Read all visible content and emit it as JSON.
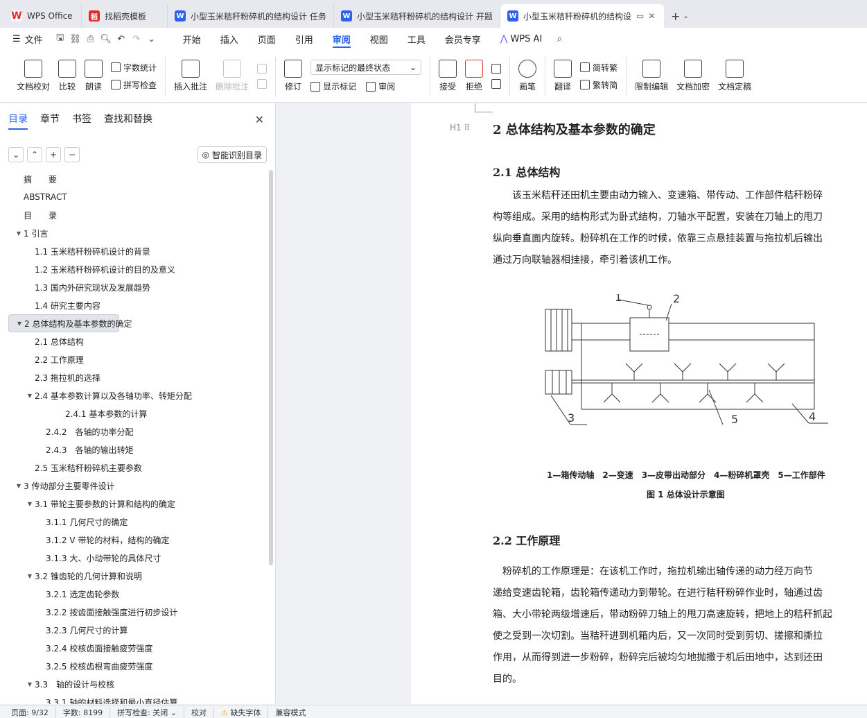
{
  "tabs": [
    {
      "label": "WPS Office",
      "icon": "wps-logo-icon"
    },
    {
      "label": "找稻壳模板",
      "icon": "docer-icon"
    },
    {
      "label": "小型玉米秸秆粉碎机的结构设计 任务",
      "icon": "word-doc-icon"
    },
    {
      "label": "小型玉米秸秆粉碎机的结构设计 开题",
      "icon": "word-doc-icon"
    },
    {
      "label": "小型玉米秸秆粉碎机的结构设",
      "icon": "word-doc-icon"
    }
  ],
  "menu": {
    "file": "文件",
    "items": [
      "开始",
      "插入",
      "页面",
      "引用",
      "审阅",
      "视图",
      "工具",
      "会员专享"
    ],
    "active": "审阅",
    "ai": "WPS AI"
  },
  "ribbon": {
    "doc_check": "文档校对",
    "compare": "比较",
    "read": "朗读",
    "word_count": "字数统计",
    "spell_check": "拼写检查",
    "insert_comment": "插入批注",
    "delete_comment": "删除批注",
    "revise": "修订",
    "markup_select": "显示标记的最终状态",
    "show_markup": "显示标记",
    "review": "审阅",
    "accept": "接受",
    "reject": "拒绝",
    "pen": "画笔",
    "translate": "翻译",
    "to_trad": "简转繁",
    "to_simp": "繁转简",
    "restrict": "限制编辑",
    "encrypt": "文档加密",
    "finalize": "文档定稿"
  },
  "nav": {
    "tabs": [
      "目录",
      "章节",
      "书签",
      "查找和替换"
    ],
    "smart_toc": "智能识别目录",
    "toc": [
      {
        "label": "摘　　要",
        "level": 0,
        "arrow": ""
      },
      {
        "label": "ABSTRACT",
        "level": 0,
        "arrow": ""
      },
      {
        "label": "目　　录",
        "level": 0,
        "arrow": ""
      },
      {
        "label": "1 引言",
        "level": 0,
        "arrow": "▼"
      },
      {
        "label": "1.1 玉米秸秆粉碎机设计的背景",
        "level": 1,
        "arrow": ""
      },
      {
        "label": "1.2 玉米秸秆粉碎机设计的目的及意义",
        "level": 1,
        "arrow": ""
      },
      {
        "label": "1.3 国内外研究现状及发展趋势",
        "level": 1,
        "arrow": ""
      },
      {
        "label": "1.4 研究主要内容",
        "level": 1,
        "arrow": ""
      },
      {
        "label": "2 总体结构及基本参数的确定",
        "level": 0,
        "arrow": "▼",
        "selected": true
      },
      {
        "label": "2.1 总体结构",
        "level": 1,
        "arrow": ""
      },
      {
        "label": "2.2 工作原理",
        "level": 1,
        "arrow": ""
      },
      {
        "label": "2.3 拖拉机的选择",
        "level": 1,
        "arrow": ""
      },
      {
        "label": "2.4 基本参数计算以及各轴功率、转矩分配",
        "level": 1,
        "arrow": "▼"
      },
      {
        "label": "2.4.1 基本参数的计算",
        "level": 3,
        "arrow": ""
      },
      {
        "label": "2.4.2　各轴的功率分配",
        "level": 2,
        "arrow": ""
      },
      {
        "label": "2.4.3　各轴的输出转矩",
        "level": 2,
        "arrow": ""
      },
      {
        "label": "2.5 玉米秸秆粉碎机主要参数",
        "level": 1,
        "arrow": ""
      },
      {
        "label": "3 传动部分主要零件设计",
        "level": 0,
        "arrow": "▼"
      },
      {
        "label": "3.1 带轮主要参数的计算和结构的确定",
        "level": 1,
        "arrow": "▼"
      },
      {
        "label": "3.1.1 几何尺寸的确定",
        "level": 2,
        "arrow": ""
      },
      {
        "label": "3.1.2 V 带轮的材料，结构的确定",
        "level": 2,
        "arrow": ""
      },
      {
        "label": "3.1.3 大、小动带轮的具体尺寸",
        "level": 2,
        "arrow": ""
      },
      {
        "label": "3.2 锥齿轮的几何计算和说明",
        "level": 1,
        "arrow": "▼"
      },
      {
        "label": "3.2.1 选定齿轮参数",
        "level": 2,
        "arrow": ""
      },
      {
        "label": "3.2.2 按齿面接触强度进行初步设计",
        "level": 2,
        "arrow": ""
      },
      {
        "label": "3.2.3 几何尺寸的计算",
        "level": 2,
        "arrow": ""
      },
      {
        "label": "3.2.4 校核齿面接触疲劳强度",
        "level": 2,
        "arrow": ""
      },
      {
        "label": "3.2.5 校核齿根弯曲疲劳强度",
        "level": 2,
        "arrow": ""
      },
      {
        "label": "3.3　轴的设计与校核",
        "level": 1,
        "arrow": "▼"
      },
      {
        "label": "3.3.1 轴的材料选择和最小直径估算",
        "level": 2,
        "arrow": ""
      }
    ]
  },
  "doc": {
    "heading_mark": "H1",
    "h1": "2 总体结构及基本参数的确定",
    "h2_1": "2.1 总体结构",
    "p1": [
      "　　该玉米秸秆还田机主要由动力输入、变速箱、带传动、工作部件秸秆粉碎",
      "构等组成。采用的结构形式为卧式结构，刀轴水平配置，安装在刀轴上的甩刀",
      "纵向垂直面内旋转。粉碎机在工作的时候，依靠三点悬挂装置与拖拉机后输出",
      "通过万向联轴器相挂接，牵引着该机工作。"
    ],
    "fig_numbers": [
      "1",
      "2",
      "3",
      "4",
      "5"
    ],
    "legend": "1—箱传动轴　2—变速　3—皮带出动部分　4—粉碎机罩壳　5—工作部件",
    "fig_caption": "图 1  总体设计示意图",
    "h2_2": "2.2 工作原理",
    "p2": [
      "　粉碎机的工作原理是：在该机工作时，拖拉机输出轴传递的动力经万向节",
      "递给变速齿轮箱，齿轮箱传递动力到带轮。在进行秸秆粉碎作业时，轴通过齿",
      "箱、大小带轮两级增速后，带动粉碎刀轴上的甩刀高速旋转，把地上的秸秆抓起",
      "使之受到一次切割。当秸秆进到机箱内后，又一次同时受到剪切、搓擦和撕拉",
      "作用，从而得到进一步粉碎，粉碎完后被均匀地抛撒于机后田地中，达到还田",
      "目的。"
    ]
  },
  "status": [
    "页面: 9/32",
    "字数: 8199",
    "拼写检查: 关闭 ⌄",
    "校对",
    "缺失字体",
    "兼容模式"
  ]
}
